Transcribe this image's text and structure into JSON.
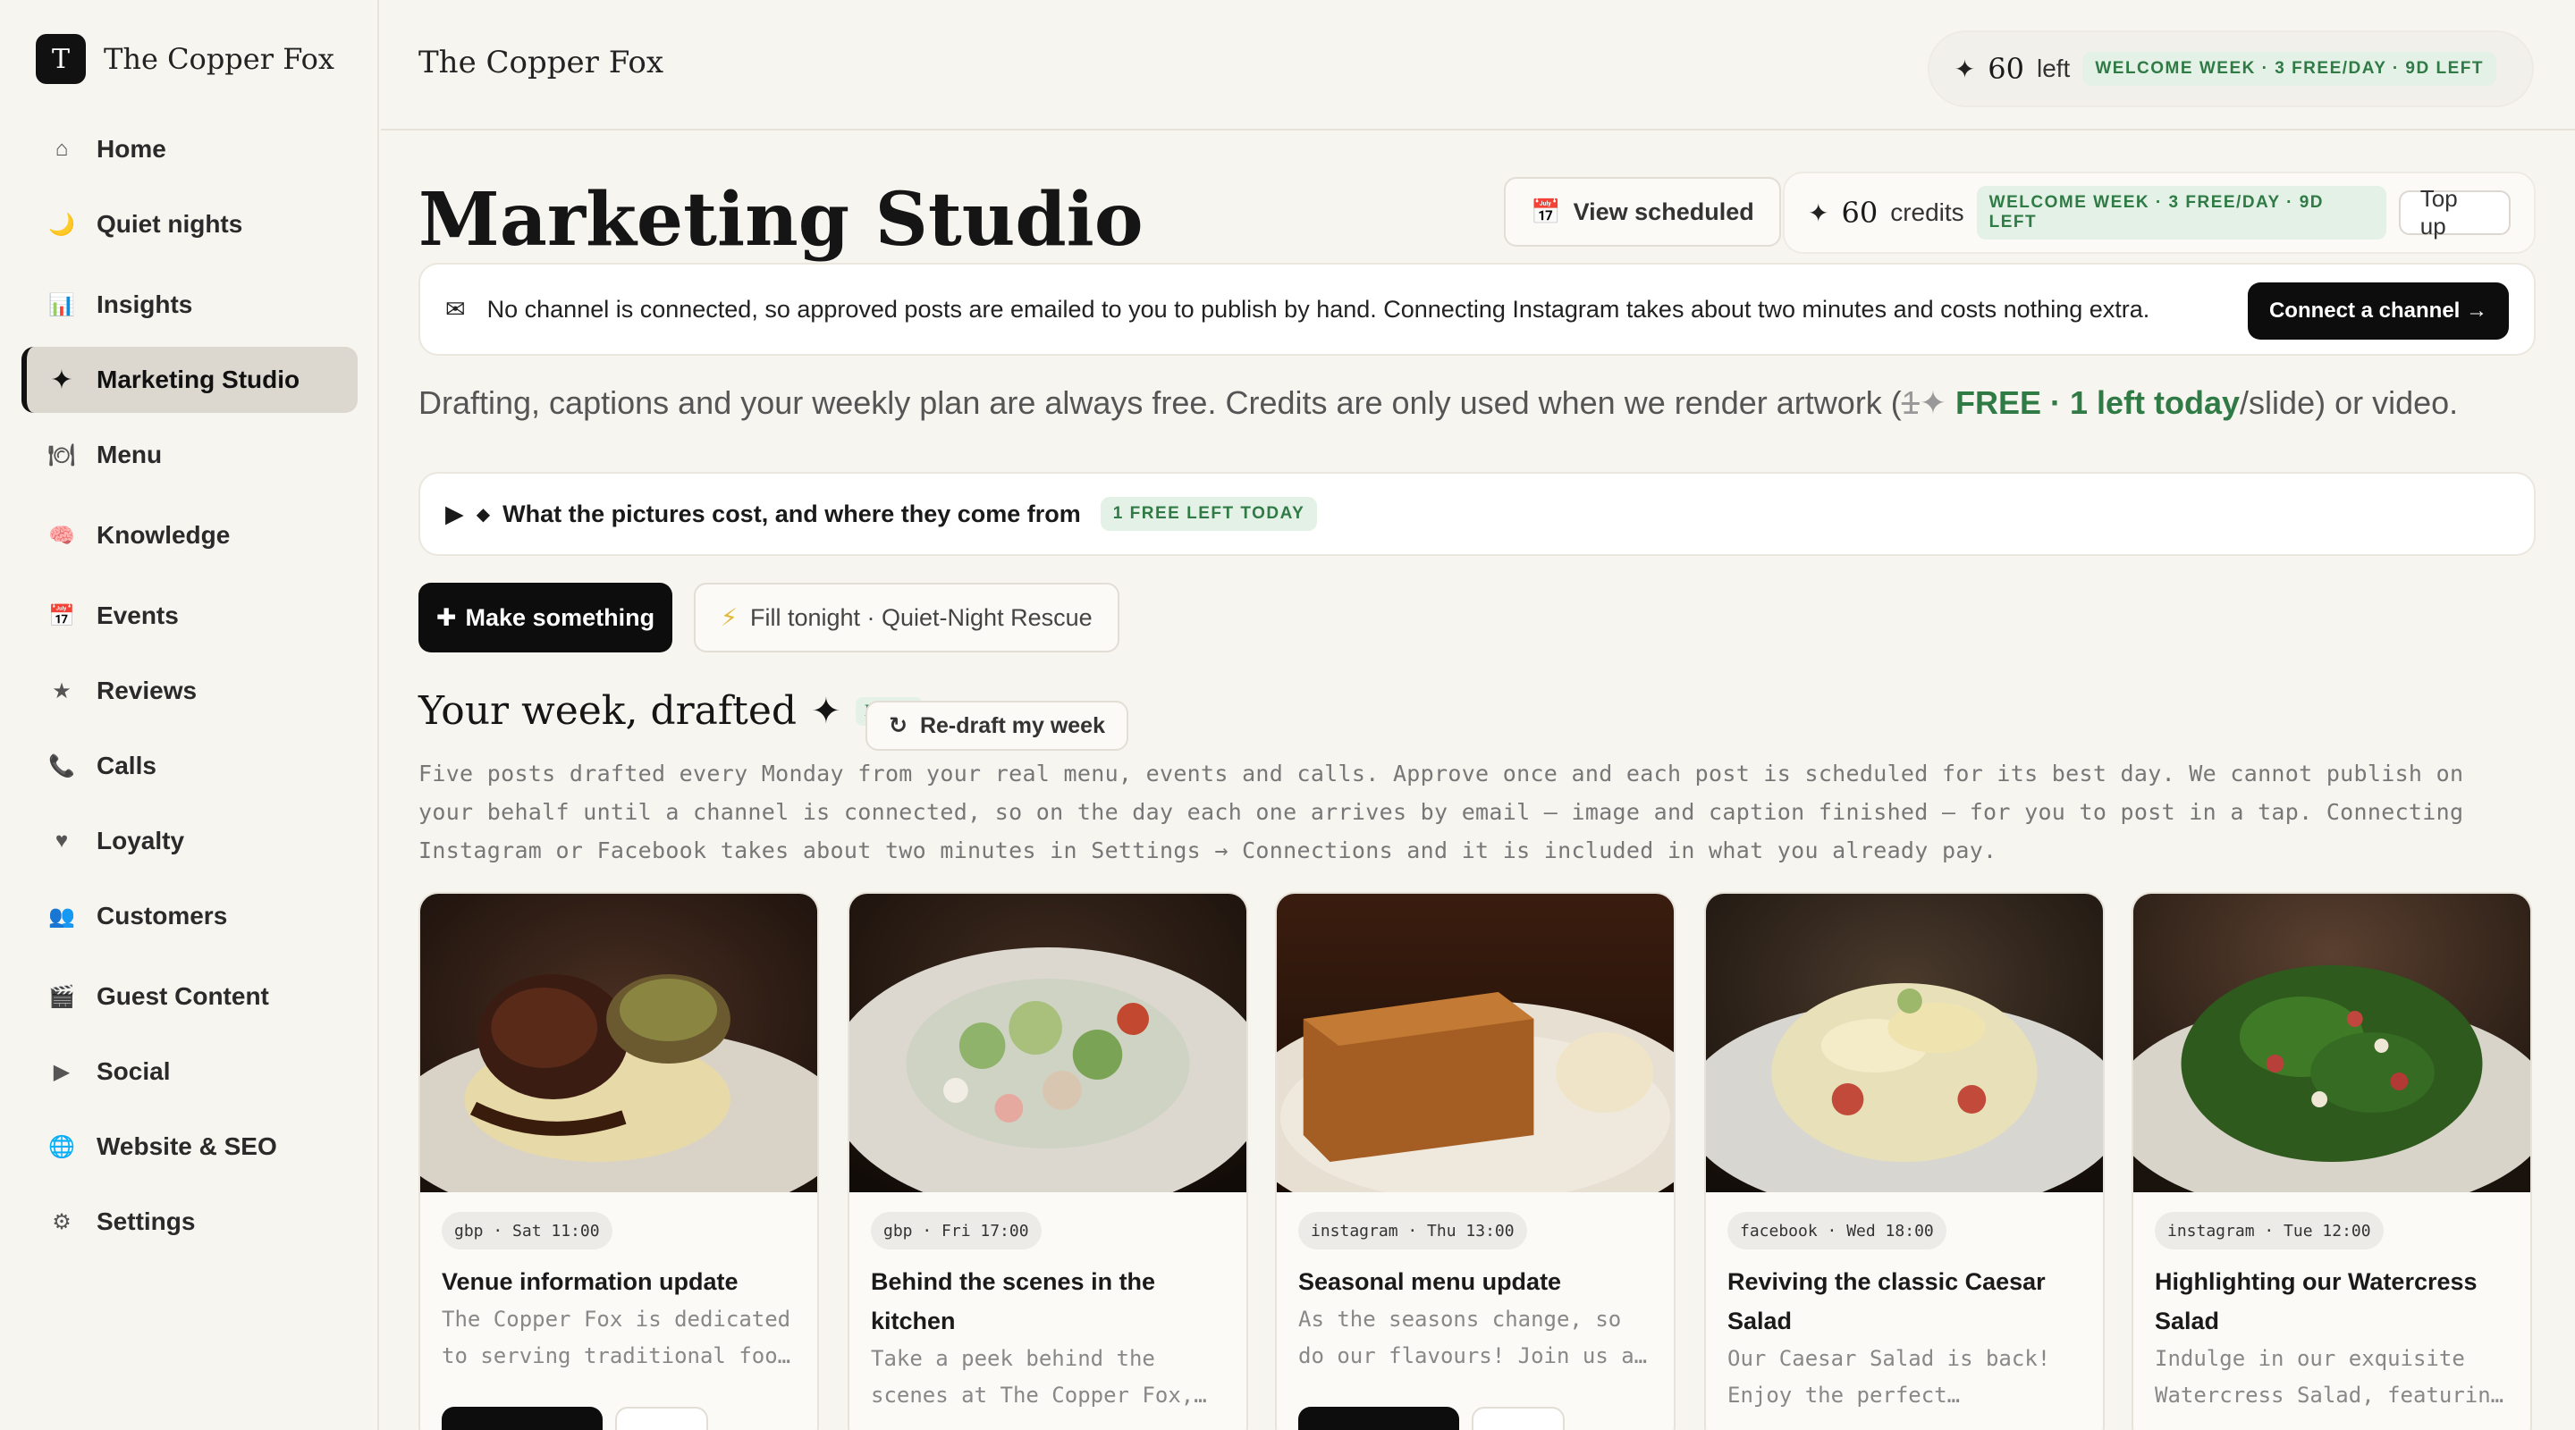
{
  "brand": {
    "logo_letter": "T",
    "name": "The Copper Fox"
  },
  "sidebar": {
    "items": [
      {
        "label": "Home",
        "icon": "home-icon",
        "glyph": "⌂"
      },
      {
        "label": "Quiet nights",
        "icon": "moon-icon",
        "glyph": "🌙"
      },
      {
        "label": "Insights",
        "icon": "bar-chart-icon",
        "glyph": "📊"
      },
      {
        "label": "Marketing Studio",
        "icon": "sparkle-icon",
        "glyph": "✦",
        "active": true
      },
      {
        "label": "Menu",
        "icon": "plate-icon",
        "glyph": "🍽"
      },
      {
        "label": "Knowledge",
        "icon": "brain-icon",
        "glyph": "🧠"
      },
      {
        "label": "Events",
        "icon": "calendar-icon",
        "glyph": "📅"
      },
      {
        "label": "Reviews",
        "icon": "star-icon",
        "glyph": "★"
      },
      {
        "label": "Calls",
        "icon": "phone-icon",
        "glyph": "📞"
      },
      {
        "label": "Loyalty",
        "icon": "heart-icon",
        "glyph": "♥"
      },
      {
        "label": "Customers",
        "icon": "people-icon",
        "glyph": "👥"
      },
      {
        "label": "Guest Content",
        "icon": "clapper-icon",
        "glyph": "🎬"
      },
      {
        "label": "Social",
        "icon": "play-icon",
        "glyph": "▶"
      },
      {
        "label": "Website & SEO",
        "icon": "globe-icon",
        "glyph": "🌐"
      },
      {
        "label": "Settings",
        "icon": "gear-icon",
        "glyph": "⚙"
      }
    ]
  },
  "topbar": {
    "title": "The Copper Fox",
    "credits_number": "60",
    "credits_word": "left",
    "welcome_badge": "WELCOME WEEK · 3 FREE/DAY · 9D LEFT"
  },
  "main": {
    "title": "Marketing Studio",
    "view_scheduled": "View scheduled",
    "credits_number": "60",
    "credits_word": "credits",
    "welcome_badge": "WELCOME WEEK · 3 FREE/DAY · 9D LEFT",
    "top_up": "Top up",
    "notice_text": "No channel is connected, so approved posts are emailed to you to publish by hand. Connecting Instagram takes about two minutes and costs nothing extra.",
    "connect_button": "Connect a channel →",
    "freeline_before": "Drafting, captions and your weekly plan are always free. Credits are only used when we render artwork (",
    "freeline_struck": "1",
    "freeline_green": "FREE · 1 left today",
    "freeline_after": "/slide) or video.",
    "details_label": "What the pictures cost, and where they come from",
    "details_badge": "1 FREE LEFT TODAY",
    "make_button": "Make something",
    "rescue_button": "Fill tonight · Quiet-Night Rescue",
    "week_title": "Your week, drafted",
    "week_free_tag": "FREE",
    "redraft_button": "Re-draft my week",
    "week_description": "Five posts drafted every Monday from your real menu, events and calls. Approve once and each post is scheduled for its best day. We cannot publish on your behalf until a channel is connected, so on the day each one arrives by email — image and caption finished — for you to post in a tap. Connecting Instagram or Facebook takes about two minutes in Settings → Connections and it is included in what you already pay."
  },
  "posts": [
    {
      "chip": "gbp · Sat 11:00",
      "title": "Venue information update",
      "body": "The Copper Fox is dedicated to serving traditional foo…",
      "has_black_action": true
    },
    {
      "chip": "gbp · Fri 17:00",
      "title": "Behind the scenes in the kitchen",
      "body": "Take a peek behind the scenes at The Copper Fox,…",
      "has_black_action": false
    },
    {
      "chip": "instagram · Thu 13:00",
      "title": "Seasonal menu update",
      "body": "As the seasons change, so do our flavours! Join us a…",
      "has_black_action": true
    },
    {
      "chip": "facebook · Wed 18:00",
      "title": "Reviving the classic Caesar Salad",
      "body": "Our Caesar Salad is back! Enjoy the perfect…",
      "has_black_action": false
    },
    {
      "chip": "instagram · Tue 12:00",
      "title": "Highlighting our Watercress Salad",
      "body": "Indulge in our exquisite Watercress Salad, featurin…",
      "has_black_action": false
    }
  ]
}
